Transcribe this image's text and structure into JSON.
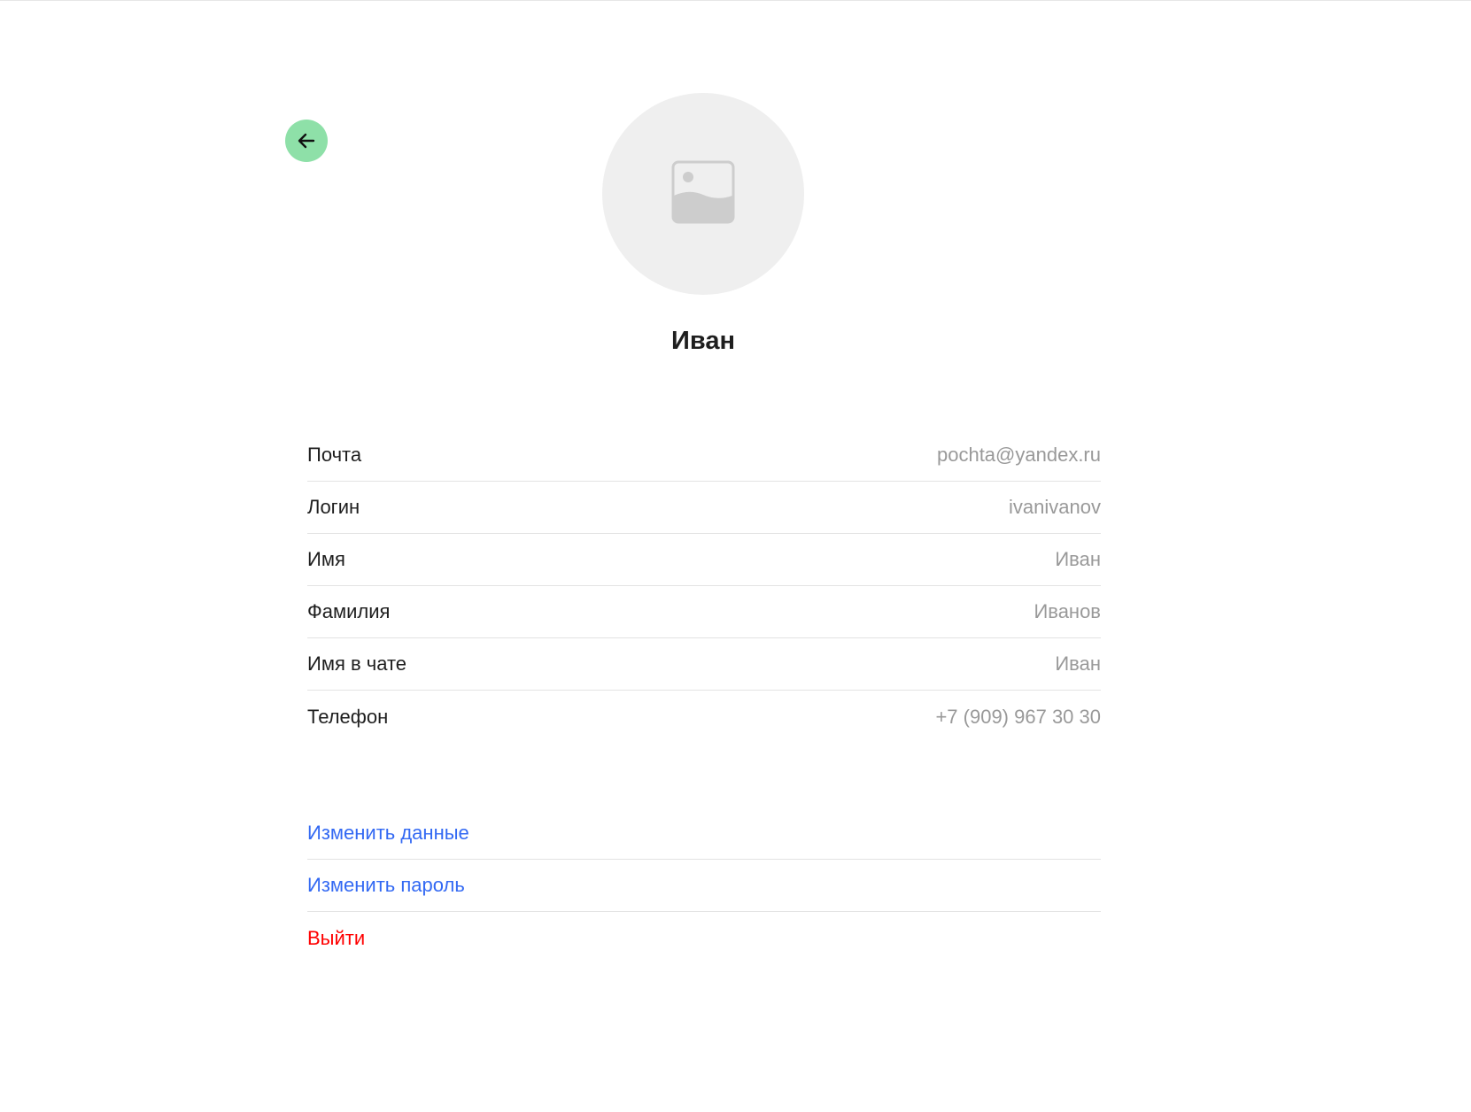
{
  "colors": {
    "back_button_bg": "#8ee0a8",
    "avatar_bg": "#efefef",
    "link": "#3369f3",
    "danger": "#ff0000",
    "muted_text": "#999999",
    "divider": "#e3e3e3"
  },
  "icons": {
    "back": "arrow-left-icon",
    "avatar_placeholder": "image-placeholder-icon"
  },
  "profile": {
    "display_name": "Иван"
  },
  "fields": [
    {
      "label": "Почта",
      "value": "pochta@yandex.ru"
    },
    {
      "label": "Логин",
      "value": "ivanivanov"
    },
    {
      "label": "Имя",
      "value": "Иван"
    },
    {
      "label": "Фамилия",
      "value": "Иванов"
    },
    {
      "label": "Имя в чате",
      "value": "Иван"
    },
    {
      "label": "Телефон",
      "value": "+7 (909) 967 30 30"
    }
  ],
  "actions": {
    "edit_data": "Изменить данные",
    "edit_password": "Изменить пароль",
    "logout": "Выйти"
  }
}
